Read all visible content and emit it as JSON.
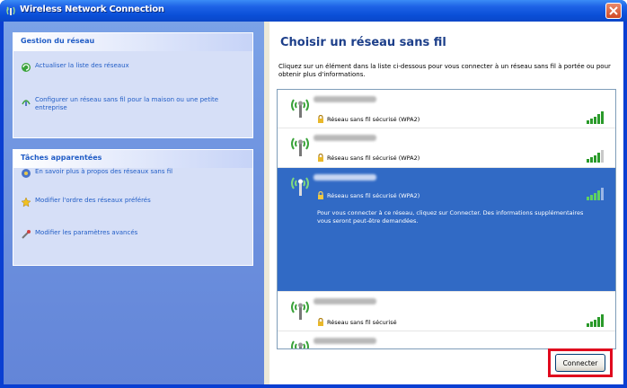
{
  "window": {
    "title": "Wireless Network Connection"
  },
  "taskpane": {
    "network_tasks": {
      "header": "Gestion du réseau",
      "items": [
        {
          "label": "Actualiser la liste des réseaux",
          "icon": "refresh-icon"
        },
        {
          "label": "Configurer un réseau sans fil pour la maison ou une petite entreprise",
          "icon": "setup-network-icon"
        }
      ]
    },
    "related_tasks": {
      "header": "Tâches apparentées",
      "items": [
        {
          "label": "En savoir plus à propos des réseaux sans fil",
          "icon": "help-icon"
        },
        {
          "label": "Modifier l'ordre des réseaux préférés",
          "icon": "star-icon"
        },
        {
          "label": "Modifier les paramètres avancés",
          "icon": "settings-icon"
        }
      ]
    }
  },
  "main": {
    "heading": "Choisir un réseau sans fil",
    "instructions": "Cliquez sur un élément dans la liste ci-dessous pour vous connecter à un réseau sans fil à portée ou pour obtenir plus d'informations.",
    "networks": [
      {
        "security": "Réseau sans fil sécurisé (WPA2)",
        "signal": 1.0,
        "selected": false
      },
      {
        "security": "Réseau sans fil sécurisé (WPA2)",
        "signal": 0.75,
        "selected": false
      },
      {
        "security": "Réseau sans fil sécurisé (WPA2)",
        "signal": 0.75,
        "selected": true,
        "description": "Pour vous connecter à ce réseau, cliquez sur Connecter. Des informations supplémentaires vous seront peut-être demandées."
      },
      {
        "security": "Réseau sans fil sécurisé",
        "signal": 1.0,
        "selected": false
      },
      {
        "security": "",
        "signal": 0,
        "selected": false
      }
    ],
    "connect_label": "Connecter"
  },
  "colors": {
    "titlebar": "#0a4fd8",
    "selection": "#316ac5",
    "highlight": "#e0091e",
    "signal": "#2a9a2a"
  }
}
